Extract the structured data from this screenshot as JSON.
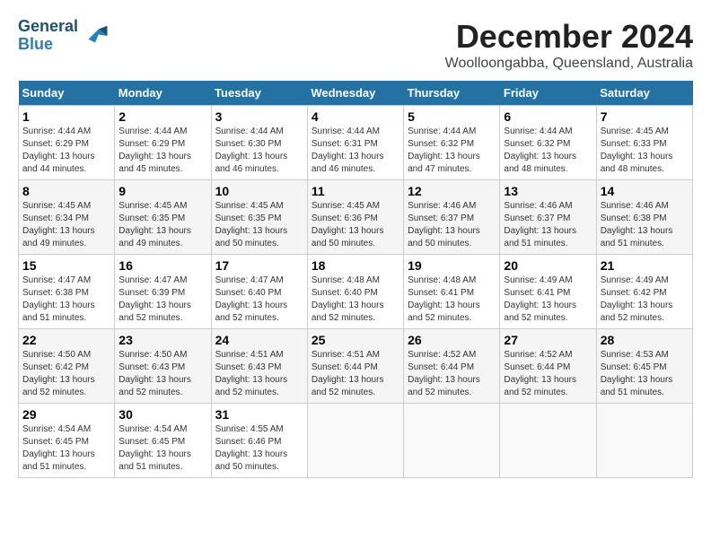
{
  "header": {
    "logo_line1": "General",
    "logo_line2": "Blue",
    "month_title": "December 2024",
    "location": "Woolloongabba, Queensland, Australia"
  },
  "columns": [
    "Sunday",
    "Monday",
    "Tuesday",
    "Wednesday",
    "Thursday",
    "Friday",
    "Saturday"
  ],
  "weeks": [
    [
      {
        "day": "1",
        "sunrise": "Sunrise: 4:44 AM",
        "sunset": "Sunset: 6:29 PM",
        "daylight": "Daylight: 13 hours and 44 minutes."
      },
      {
        "day": "2",
        "sunrise": "Sunrise: 4:44 AM",
        "sunset": "Sunset: 6:29 PM",
        "daylight": "Daylight: 13 hours and 45 minutes."
      },
      {
        "day": "3",
        "sunrise": "Sunrise: 4:44 AM",
        "sunset": "Sunset: 6:30 PM",
        "daylight": "Daylight: 13 hours and 46 minutes."
      },
      {
        "day": "4",
        "sunrise": "Sunrise: 4:44 AM",
        "sunset": "Sunset: 6:31 PM",
        "daylight": "Daylight: 13 hours and 46 minutes."
      },
      {
        "day": "5",
        "sunrise": "Sunrise: 4:44 AM",
        "sunset": "Sunset: 6:32 PM",
        "daylight": "Daylight: 13 hours and 47 minutes."
      },
      {
        "day": "6",
        "sunrise": "Sunrise: 4:44 AM",
        "sunset": "Sunset: 6:32 PM",
        "daylight": "Daylight: 13 hours and 48 minutes."
      },
      {
        "day": "7",
        "sunrise": "Sunrise: 4:45 AM",
        "sunset": "Sunset: 6:33 PM",
        "daylight": "Daylight: 13 hours and 48 minutes."
      }
    ],
    [
      {
        "day": "8",
        "sunrise": "Sunrise: 4:45 AM",
        "sunset": "Sunset: 6:34 PM",
        "daylight": "Daylight: 13 hours and 49 minutes."
      },
      {
        "day": "9",
        "sunrise": "Sunrise: 4:45 AM",
        "sunset": "Sunset: 6:35 PM",
        "daylight": "Daylight: 13 hours and 49 minutes."
      },
      {
        "day": "10",
        "sunrise": "Sunrise: 4:45 AM",
        "sunset": "Sunset: 6:35 PM",
        "daylight": "Daylight: 13 hours and 50 minutes."
      },
      {
        "day": "11",
        "sunrise": "Sunrise: 4:45 AM",
        "sunset": "Sunset: 6:36 PM",
        "daylight": "Daylight: 13 hours and 50 minutes."
      },
      {
        "day": "12",
        "sunrise": "Sunrise: 4:46 AM",
        "sunset": "Sunset: 6:37 PM",
        "daylight": "Daylight: 13 hours and 50 minutes."
      },
      {
        "day": "13",
        "sunrise": "Sunrise: 4:46 AM",
        "sunset": "Sunset: 6:37 PM",
        "daylight": "Daylight: 13 hours and 51 minutes."
      },
      {
        "day": "14",
        "sunrise": "Sunrise: 4:46 AM",
        "sunset": "Sunset: 6:38 PM",
        "daylight": "Daylight: 13 hours and 51 minutes."
      }
    ],
    [
      {
        "day": "15",
        "sunrise": "Sunrise: 4:47 AM",
        "sunset": "Sunset: 6:38 PM",
        "daylight": "Daylight: 13 hours and 51 minutes."
      },
      {
        "day": "16",
        "sunrise": "Sunrise: 4:47 AM",
        "sunset": "Sunset: 6:39 PM",
        "daylight": "Daylight: 13 hours and 52 minutes."
      },
      {
        "day": "17",
        "sunrise": "Sunrise: 4:47 AM",
        "sunset": "Sunset: 6:40 PM",
        "daylight": "Daylight: 13 hours and 52 minutes."
      },
      {
        "day": "18",
        "sunrise": "Sunrise: 4:48 AM",
        "sunset": "Sunset: 6:40 PM",
        "daylight": "Daylight: 13 hours and 52 minutes."
      },
      {
        "day": "19",
        "sunrise": "Sunrise: 4:48 AM",
        "sunset": "Sunset: 6:41 PM",
        "daylight": "Daylight: 13 hours and 52 minutes."
      },
      {
        "day": "20",
        "sunrise": "Sunrise: 4:49 AM",
        "sunset": "Sunset: 6:41 PM",
        "daylight": "Daylight: 13 hours and 52 minutes."
      },
      {
        "day": "21",
        "sunrise": "Sunrise: 4:49 AM",
        "sunset": "Sunset: 6:42 PM",
        "daylight": "Daylight: 13 hours and 52 minutes."
      }
    ],
    [
      {
        "day": "22",
        "sunrise": "Sunrise: 4:50 AM",
        "sunset": "Sunset: 6:42 PM",
        "daylight": "Daylight: 13 hours and 52 minutes."
      },
      {
        "day": "23",
        "sunrise": "Sunrise: 4:50 AM",
        "sunset": "Sunset: 6:43 PM",
        "daylight": "Daylight: 13 hours and 52 minutes."
      },
      {
        "day": "24",
        "sunrise": "Sunrise: 4:51 AM",
        "sunset": "Sunset: 6:43 PM",
        "daylight": "Daylight: 13 hours and 52 minutes."
      },
      {
        "day": "25",
        "sunrise": "Sunrise: 4:51 AM",
        "sunset": "Sunset: 6:44 PM",
        "daylight": "Daylight: 13 hours and 52 minutes."
      },
      {
        "day": "26",
        "sunrise": "Sunrise: 4:52 AM",
        "sunset": "Sunset: 6:44 PM",
        "daylight": "Daylight: 13 hours and 52 minutes."
      },
      {
        "day": "27",
        "sunrise": "Sunrise: 4:52 AM",
        "sunset": "Sunset: 6:44 PM",
        "daylight": "Daylight: 13 hours and 52 minutes."
      },
      {
        "day": "28",
        "sunrise": "Sunrise: 4:53 AM",
        "sunset": "Sunset: 6:45 PM",
        "daylight": "Daylight: 13 hours and 51 minutes."
      }
    ],
    [
      {
        "day": "29",
        "sunrise": "Sunrise: 4:54 AM",
        "sunset": "Sunset: 6:45 PM",
        "daylight": "Daylight: 13 hours and 51 minutes."
      },
      {
        "day": "30",
        "sunrise": "Sunrise: 4:54 AM",
        "sunset": "Sunset: 6:45 PM",
        "daylight": "Daylight: 13 hours and 51 minutes."
      },
      {
        "day": "31",
        "sunrise": "Sunrise: 4:55 AM",
        "sunset": "Sunset: 6:46 PM",
        "daylight": "Daylight: 13 hours and 50 minutes."
      },
      null,
      null,
      null,
      null
    ]
  ]
}
